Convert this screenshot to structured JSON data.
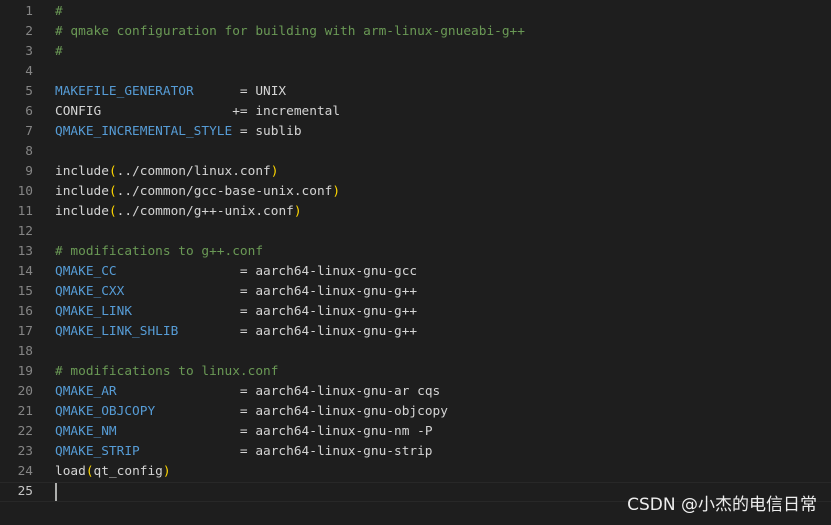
{
  "colors": {
    "background": "#1e1e1e",
    "comment": "#6a9955",
    "variable": "#569cd6",
    "text": "#d4d4d4",
    "paren": "#ffd700",
    "line_number": "#858585"
  },
  "lines": [
    {
      "num": "1",
      "tokens": [
        {
          "t": "#",
          "c": "comment"
        }
      ]
    },
    {
      "num": "2",
      "tokens": [
        {
          "t": "# qmake configuration for building with arm-linux-gnueabi-g++",
          "c": "comment"
        }
      ]
    },
    {
      "num": "3",
      "tokens": [
        {
          "t": "#",
          "c": "comment"
        }
      ]
    },
    {
      "num": "4",
      "tokens": []
    },
    {
      "num": "5",
      "tokens": [
        {
          "t": "MAKEFILE_GENERATOR",
          "c": "var"
        },
        {
          "t": "      = UNIX",
          "c": "plain"
        }
      ]
    },
    {
      "num": "6",
      "tokens": [
        {
          "t": "CONFIG                 += incremental",
          "c": "plain"
        }
      ]
    },
    {
      "num": "7",
      "tokens": [
        {
          "t": "QMAKE_INCREMENTAL_STYLE",
          "c": "var"
        },
        {
          "t": " = sublib",
          "c": "plain"
        }
      ]
    },
    {
      "num": "8",
      "tokens": []
    },
    {
      "num": "9",
      "tokens": [
        {
          "t": "include",
          "c": "plain"
        },
        {
          "t": "(",
          "c": "paren"
        },
        {
          "t": "../common/linux.conf",
          "c": "plain"
        },
        {
          "t": ")",
          "c": "paren"
        }
      ]
    },
    {
      "num": "10",
      "tokens": [
        {
          "t": "include",
          "c": "plain"
        },
        {
          "t": "(",
          "c": "paren"
        },
        {
          "t": "../common/gcc-base-unix.conf",
          "c": "plain"
        },
        {
          "t": ")",
          "c": "paren"
        }
      ]
    },
    {
      "num": "11",
      "tokens": [
        {
          "t": "include",
          "c": "plain"
        },
        {
          "t": "(",
          "c": "paren"
        },
        {
          "t": "../common/g++-unix.conf",
          "c": "plain"
        },
        {
          "t": ")",
          "c": "paren"
        }
      ]
    },
    {
      "num": "12",
      "tokens": []
    },
    {
      "num": "13",
      "tokens": [
        {
          "t": "# modifications to g++.conf",
          "c": "comment"
        }
      ]
    },
    {
      "num": "14",
      "tokens": [
        {
          "t": "QMAKE_CC",
          "c": "var"
        },
        {
          "t": "                = aarch64-linux-gnu-gcc",
          "c": "plain"
        }
      ]
    },
    {
      "num": "15",
      "tokens": [
        {
          "t": "QMAKE_CXX",
          "c": "var"
        },
        {
          "t": "               = aarch64-linux-gnu-g++",
          "c": "plain"
        }
      ]
    },
    {
      "num": "16",
      "tokens": [
        {
          "t": "QMAKE_LINK",
          "c": "var"
        },
        {
          "t": "              = aarch64-linux-gnu-g++",
          "c": "plain"
        }
      ]
    },
    {
      "num": "17",
      "tokens": [
        {
          "t": "QMAKE_LINK_SHLIB",
          "c": "var"
        },
        {
          "t": "        = aarch64-linux-gnu-g++",
          "c": "plain"
        }
      ]
    },
    {
      "num": "18",
      "tokens": []
    },
    {
      "num": "19",
      "tokens": [
        {
          "t": "# modifications to linux.conf",
          "c": "comment"
        }
      ]
    },
    {
      "num": "20",
      "tokens": [
        {
          "t": "QMAKE_AR",
          "c": "var"
        },
        {
          "t": "                = aarch64-linux-gnu-ar cqs",
          "c": "plain"
        }
      ]
    },
    {
      "num": "21",
      "tokens": [
        {
          "t": "QMAKE_OBJCOPY",
          "c": "var"
        },
        {
          "t": "           = aarch64-linux-gnu-objcopy",
          "c": "plain"
        }
      ]
    },
    {
      "num": "22",
      "tokens": [
        {
          "t": "QMAKE_NM",
          "c": "var"
        },
        {
          "t": "                = aarch64-linux-gnu-nm -P",
          "c": "plain"
        }
      ]
    },
    {
      "num": "23",
      "tokens": [
        {
          "t": "QMAKE_STRIP",
          "c": "var"
        },
        {
          "t": "             = aarch64-linux-gnu-strip",
          "c": "plain"
        }
      ]
    },
    {
      "num": "24",
      "tokens": [
        {
          "t": "load",
          "c": "plain"
        },
        {
          "t": "(",
          "c": "paren"
        },
        {
          "t": "qt_config",
          "c": "plain"
        },
        {
          "t": ")",
          "c": "paren"
        }
      ]
    },
    {
      "num": "25",
      "tokens": [],
      "current": true
    }
  ],
  "watermark": "CSDN @小杰的电信日常"
}
